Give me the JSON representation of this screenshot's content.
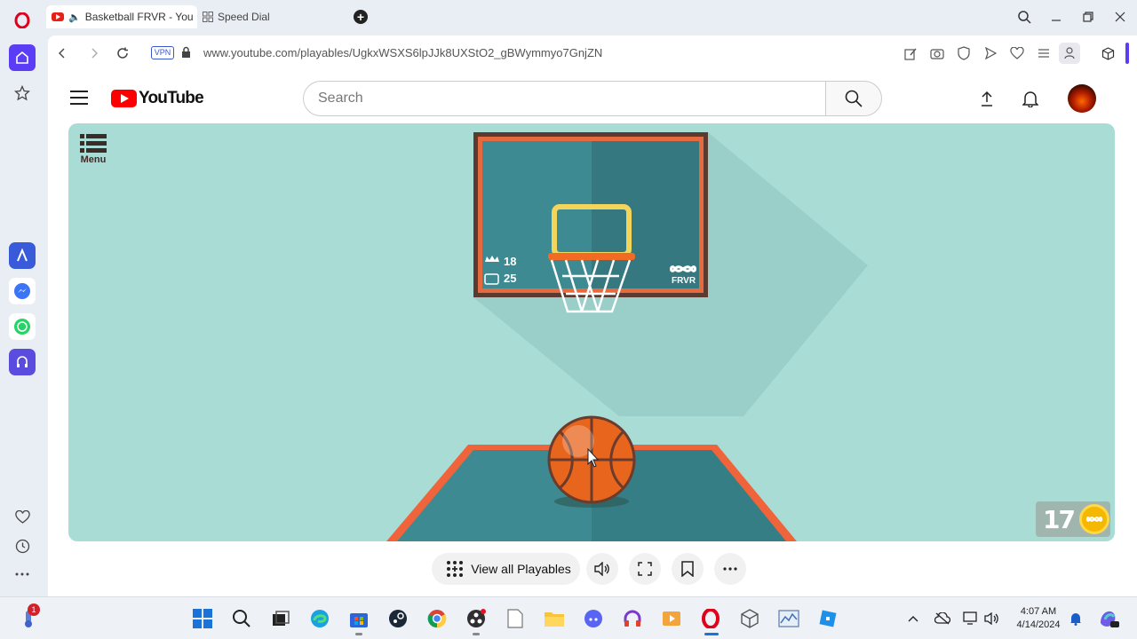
{
  "browser": {
    "tabs": [
      {
        "title": "Basketball FRVR - You",
        "active": true
      },
      {
        "title": "Speed Dial",
        "active": false
      }
    ],
    "url": "www.youtube.com/playables/UgkxWSXS6lpJJk8UXStO2_gBWymmyo7GnjZN",
    "vpn_label": "VPN"
  },
  "youtube": {
    "logo_text": "YouTube",
    "search_placeholder": "Search"
  },
  "game": {
    "menu_label": "Menu",
    "best_score": "18",
    "current_score": "25",
    "brand": "FRVR",
    "coins": "17",
    "colors": {
      "background": "#aadcd6",
      "board": "#3e8a92",
      "rim": "#f26a24",
      "ball": "#e8651d"
    }
  },
  "controls": {
    "view_all_label": "View all Playables"
  },
  "taskbar": {
    "time": "4:07 AM",
    "date": "4/14/2024",
    "notification_count": "1"
  }
}
